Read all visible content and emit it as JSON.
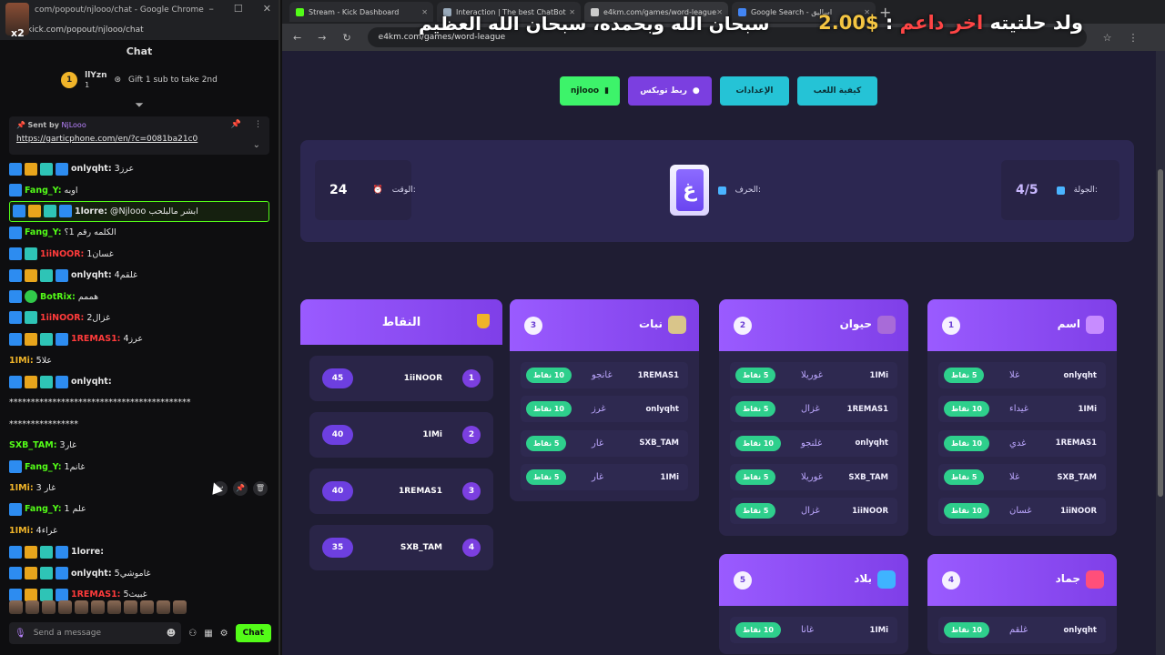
{
  "chat_window": {
    "title": "com/popout/njlooo/chat - Google Chrome",
    "url": "kick.com/popout/njlooo/chat",
    "badge_text": "x2",
    "header": "Chat",
    "leader": {
      "rank": "1",
      "name": "llYzn",
      "count": "1",
      "gift_text": "Gift 1 sub to take 2nd"
    },
    "pinned": {
      "sent_by_label": "Sent by",
      "sender": "NjLooo",
      "link": "https://garticphone.com/en/?c=0081ba21c0"
    },
    "messages": [
      {
        "badges": [
          "blue",
          "gold",
          "cyan",
          "blue"
        ],
        "user": "onlyqht:",
        "user_color": "#e6e6e6",
        "text": "عرز3"
      },
      {
        "badges": [
          "blue"
        ],
        "user": "Fang_Y:",
        "user_color": "#53fc18",
        "text": "اوبه"
      },
      {
        "badges": [
          "blue",
          "gold",
          "cyan",
          "blue"
        ],
        "user": "1lorre:",
        "user_color": "#e6e6e6",
        "text": "@Njlooo ابشر مالبلحب",
        "highlight": true
      },
      {
        "badges": [
          "blue"
        ],
        "user": "Fang_Y:",
        "user_color": "#53fc18",
        "text": "الكلمه رقم 1؟"
      },
      {
        "badges": [
          "blue",
          "cyan"
        ],
        "user": "1iiNOOR:",
        "user_color": "#ff3b3b",
        "text": "غسان1"
      },
      {
        "badges": [
          "blue",
          "gold",
          "cyan",
          "blue"
        ],
        "user": "onlyqht:",
        "user_color": "#e6e6e6",
        "text": "4غلقم"
      },
      {
        "badges": [
          "blue",
          "green"
        ],
        "user": "BotRix:",
        "user_color": "#53fc18",
        "text": "هممم"
      },
      {
        "badges": [
          "blue",
          "cyan"
        ],
        "user": "1iiNOOR:",
        "user_color": "#ff3b3b",
        "text": "غزال2"
      },
      {
        "badges": [
          "blue",
          "gold",
          "cyan",
          "blue"
        ],
        "user": "1REMAS1:",
        "user_color": "#ff3b3b",
        "text": "عرز4"
      },
      {
        "badges": [],
        "user": "1IMi:",
        "user_color": "#f0b429",
        "text": "5علا"
      },
      {
        "badges": [
          "blue",
          "gold",
          "cyan",
          "blue"
        ],
        "user": "onlyqht:",
        "user_color": "#e6e6e6",
        "text": ""
      },
      {
        "badges": [],
        "user": "",
        "user_color": "#e6e6e6",
        "text": "******************************************"
      },
      {
        "badges": [],
        "user": "",
        "user_color": "#e6e6e6",
        "text": "****************"
      },
      {
        "badges": [],
        "user": "SXB_TAM:",
        "user_color": "#53fc18",
        "text": "غار3"
      },
      {
        "badges": [
          "blue"
        ],
        "user": "Fang_Y:",
        "user_color": "#53fc18",
        "text": "1غانم"
      },
      {
        "badges": [],
        "user": "1IMi:",
        "user_color": "#f0b429",
        "text": "غار 3",
        "actions": true
      },
      {
        "badges": [
          "blue"
        ],
        "user": "Fang_Y:",
        "user_color": "#53fc18",
        "text": "1 علم"
      },
      {
        "badges": [],
        "user": "1IMi:",
        "user_color": "#f0b429",
        "text": "غراء4"
      },
      {
        "badges": [
          "blue",
          "gold",
          "cyan",
          "blue"
        ],
        "user": "1lorre:",
        "user_color": "#e6e6e6",
        "text": ""
      },
      {
        "badges": [
          "blue",
          "gold",
          "cyan",
          "blue"
        ],
        "user": "onlyqht:",
        "user_color": "#e6e6e6",
        "text": "غاموشي5"
      },
      {
        "badges": [
          "blue",
          "gold",
          "cyan",
          "blue"
        ],
        "user": "1REMAS1:",
        "user_color": "#ff3b3b",
        "text": "5غبيث"
      }
    ],
    "composer": {
      "placeholder": "Send a message",
      "send_label": "Chat"
    }
  },
  "browser": {
    "tabs": [
      {
        "title": "Stream - Kick Dashboard",
        "fav_color": "#53fc18"
      },
      {
        "title": "Interaction | The best ChatBot",
        "fav_color": "#9ab"
      },
      {
        "title": "e4km.com/games/word-league",
        "fav_color": "#ccc",
        "active": true
      },
      {
        "title": "Google Search - اساليق",
        "fav_color": "#4285f4"
      }
    ],
    "address": "e4km.com/games/word-league",
    "overlay_dua": "سبحان الله وبحمده، سبحان الله العظيم",
    "overlay_goal": {
      "prefix": "ولد حلتيته",
      "mid": "اخر داعم",
      "sep": ":",
      "amount": "$2.00"
    }
  },
  "game": {
    "buttons": {
      "user": "njlooo",
      "link_kick": "ربط توبكس",
      "settings": "الإعدادات",
      "how_to": "كيفية اللعب"
    },
    "timer_label": "الوقت:",
    "timer_value": "24",
    "letter_label": "الحرف:",
    "letter": "غ",
    "round_label": "الجولة:",
    "round_value": "4/5",
    "scores_title": "النقاط",
    "scores": [
      {
        "rank": "1",
        "name": "1iiNOOR",
        "points": "45"
      },
      {
        "rank": "2",
        "name": "1IMi",
        "points": "40"
      },
      {
        "rank": "3",
        "name": "1REMAS1",
        "points": "40"
      },
      {
        "rank": "4",
        "name": "SXB_TAM",
        "points": "35"
      }
    ],
    "categories": [
      {
        "num": "1",
        "title": "اسم",
        "icon_color": "#c78cff",
        "rows": [
          {
            "player": "onlyqht",
            "word": "غلا",
            "points": "5 نقاط"
          },
          {
            "player": "1IMi",
            "word": "غيداء",
            "points": "10 نقاط"
          },
          {
            "player": "1REMAS1",
            "word": "غدي",
            "points": "10 نقاط"
          },
          {
            "player": "SXB_TAM",
            "word": "غلا",
            "points": "5 نقاط"
          },
          {
            "player": "1iiNOOR",
            "word": "غسان",
            "points": "10 نقاط"
          }
        ]
      },
      {
        "num": "2",
        "title": "حيوان",
        "icon_color": "#a86bd8",
        "rows": [
          {
            "player": "1IMi",
            "word": "غوريلا",
            "points": "5 نقاط"
          },
          {
            "player": "1REMAS1",
            "word": "غزال",
            "points": "5 نقاط"
          },
          {
            "player": "onlyqht",
            "word": "غلنجو",
            "points": "10 نقاط"
          },
          {
            "player": "SXB_TAM",
            "word": "غوريلا",
            "points": "5 نقاط"
          },
          {
            "player": "1iiNOOR",
            "word": "غزال",
            "points": "5 نقاط"
          }
        ]
      },
      {
        "num": "3",
        "title": "نبات",
        "icon_color": "#d9c58a",
        "rows": [
          {
            "player": "1REMAS1",
            "word": "غانجو",
            "points": "10 نقاط"
          },
          {
            "player": "onlyqht",
            "word": "غرز",
            "points": "10 نقاط"
          },
          {
            "player": "SXB_TAM",
            "word": "غار",
            "points": "5 نقاط"
          },
          {
            "player": "1IMi",
            "word": "غار",
            "points": "5 نقاط"
          }
        ]
      },
      {
        "num": "4",
        "title": "جماد",
        "icon_color": "#ff4f7a",
        "rows": [
          {
            "player": "onlyqht",
            "word": "غلقم",
            "points": "10 نقاط"
          }
        ]
      },
      {
        "num": "5",
        "title": "بلاد",
        "icon_color": "#3fb3ff",
        "rows": [
          {
            "player": "1IMi",
            "word": "غانا",
            "points": "10 نقاط"
          }
        ]
      }
    ]
  }
}
